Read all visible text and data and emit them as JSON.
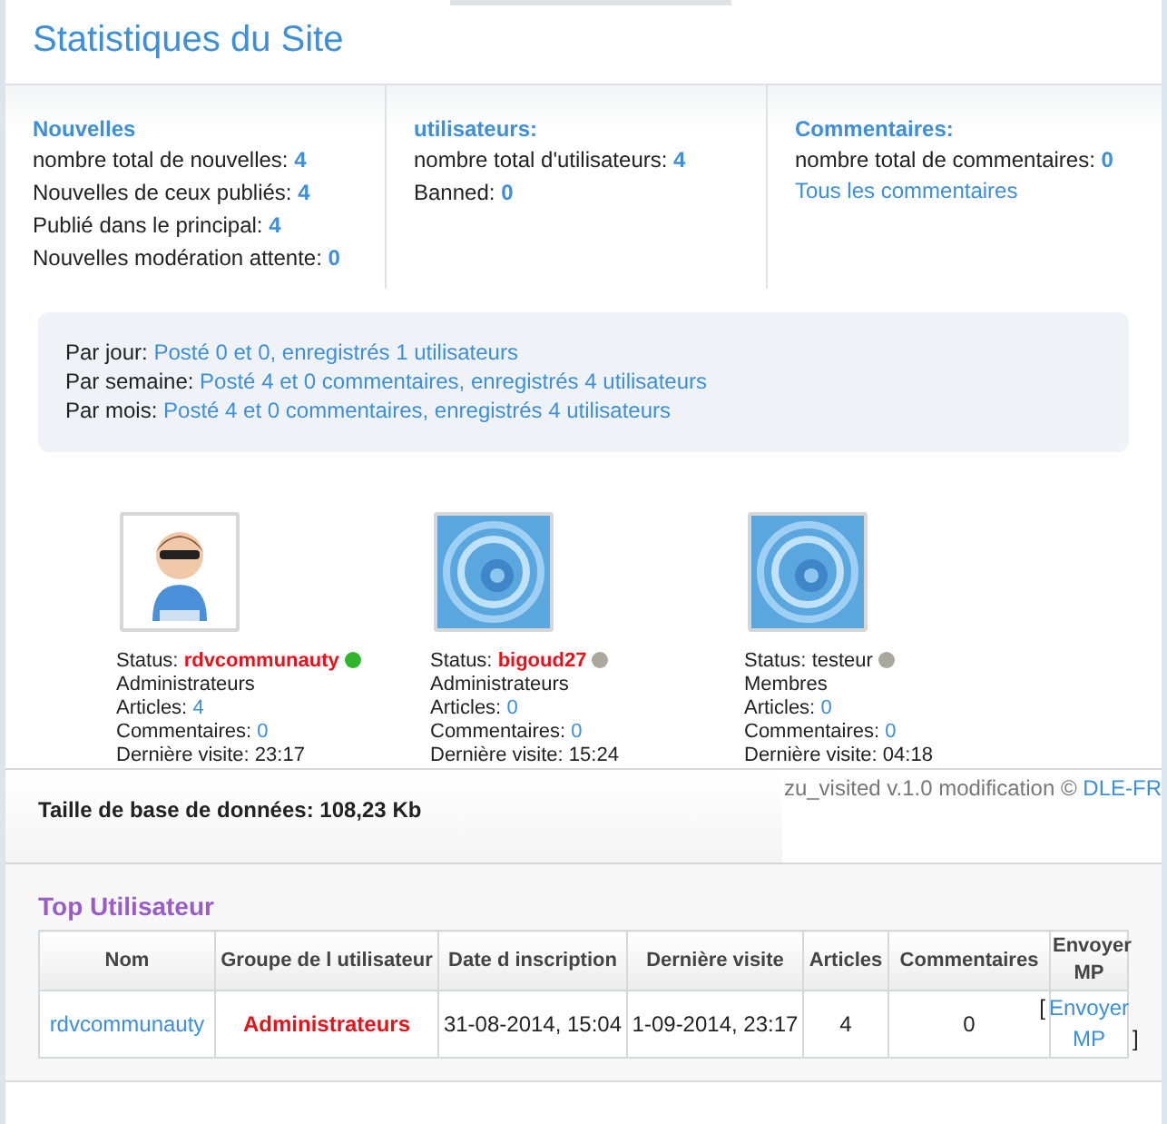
{
  "title": "Statistiques du Site",
  "columns": [
    {
      "heading": "Nouvelles",
      "lines": [
        {
          "label": "nombre total de nouvelles:",
          "value": "4"
        },
        {
          "label": "Nouvelles de ceux publiés:",
          "value": "4"
        },
        {
          "label": "Publié dans le principal:",
          "value": "4"
        },
        {
          "label": "Nouvelles modération attente:",
          "value": "0"
        }
      ]
    },
    {
      "heading": "utilisateurs:",
      "lines": [
        {
          "label": "nombre total d'utilisateurs:",
          "value": "4"
        },
        {
          "label": "Banned:",
          "value": "0"
        }
      ]
    },
    {
      "heading": "Commentaires:",
      "lines": [
        {
          "label": "nombre total de commentaires:",
          "value": "0"
        }
      ],
      "link": "Tous les commentaires"
    }
  ],
  "periods": [
    {
      "label": "Par jour:",
      "value": "Posté 0 et 0, enregistrés 1 utilisateurs"
    },
    {
      "label": "Par semaine:",
      "value": "Posté 4 et 0 commentaires, enregistrés 4 utilisateurs"
    },
    {
      "label": "Par mois:",
      "value": "Posté 4 et 0 commentaires, enregistrés 4 utilisateurs"
    }
  ],
  "users": [
    {
      "avatar": {
        "kind": "figure"
      },
      "status_label": "Status:",
      "name": "rdvcommunauty",
      "kind": "admin",
      "online": true,
      "group": "Administrateurs",
      "articles_label": "Articles:",
      "articles": "4",
      "comments_label": "Commentaires:",
      "comments": "0",
      "last_visit": "Dernière visite: 23:17"
    },
    {
      "avatar": {
        "kind": "logo"
      },
      "status_label": "Status:",
      "name": "bigoud27",
      "kind": "admin",
      "online": false,
      "group": "Administrateurs",
      "articles_label": "Articles:",
      "articles": "0",
      "comments_label": "Commentaires:",
      "comments": "0",
      "last_visit": "Dernière visite: 15:24"
    },
    {
      "avatar": {
        "kind": "logo"
      },
      "status_label": "Status:",
      "name": "testeur",
      "kind": "member",
      "online": false,
      "group": "Membres",
      "articles_label": "Articles:",
      "articles": "0",
      "comments_label": "Commentaires:",
      "comments": "0",
      "last_visit": "Dernière visite: 04:18"
    }
  ],
  "db_size": "Taille de base de données: 108,23 Kb",
  "credit": {
    "text": "zu_visited v.1.0 modification ©",
    "link": "DLE-FR"
  },
  "top": {
    "title": "Top Utilisateur",
    "columns": [
      "Nom",
      "Groupe de l utilisateur",
      "Date d inscription",
      "Dernière visite",
      "Articles",
      "Commentaires",
      "Envoyer MP"
    ],
    "rows": [
      {
        "name": "rdvcommunauty",
        "group": "Administrateurs",
        "registered": "31-08-2014, 15:04",
        "last_visit": "1-09-2014, 23:17",
        "articles": "4",
        "comments": "0",
        "mp_open": "[",
        "mp_link": "Envoyer MP",
        "mp_close": "]"
      }
    ]
  }
}
